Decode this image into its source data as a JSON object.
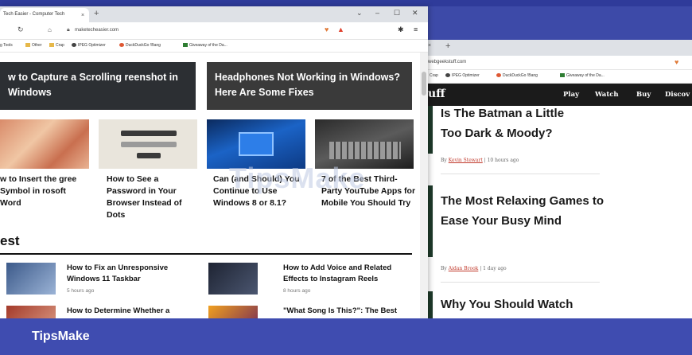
{
  "left_window": {
    "tab_title": "Tech Easier - Computer Tech",
    "tab_close": "×",
    "new_tab": "+",
    "window_controls": [
      "⌄",
      "–",
      "☐",
      "✕"
    ],
    "url": "maketecheasier.com",
    "bookmarks": [
      "g Tools",
      "Other",
      "Crap",
      "IPEG Optimizer",
      "DuckDuckGo !Bang",
      "Giveaway of the Da..."
    ],
    "hero": [
      "w to Capture a Scrolling reenshot in Windows",
      "Headphones Not Working in Windows? Here Are Some Fixes"
    ],
    "cards": [
      "w to Insert the gree Symbol in rosoft Word",
      "How to See a Password in Your Browser Instead of Dots",
      "Can (and Should) You Continue to Use Windows 8 or 8.1?",
      "7 of the Best Third-Party YouTube Apps for Mobile You Should Try"
    ],
    "latest_heading": "est",
    "latest": [
      {
        "title": "How to Fix an Unresponsive Windows 11 Taskbar",
        "time": "5 hours ago"
      },
      {
        "title": "How to Add Voice and Related Effects to Instagram Reels",
        "time": "8 hours ago"
      },
      {
        "title": "How to Determine Whether a",
        "time": ""
      },
      {
        "title": "\"What Song Is This?\": The Best",
        "time": ""
      }
    ]
  },
  "right_window": {
    "tab_close": "×",
    "new_tab": "+",
    "url": "webgeekstuff.com",
    "bookmarks": [
      "Crap",
      "IPEG Optimizer",
      "DuckDuckGo !Bang",
      "Giveaway of the Da..."
    ],
    "logo": "uff",
    "nav": [
      "Play",
      "Watch",
      "Buy",
      "Discov"
    ],
    "articles": [
      {
        "title": "Is The Batman a Little Too Dark & Moody?",
        "by": "By",
        "author": "Kevin Stewart",
        "time": "| 10 hours ago"
      },
      {
        "title": "The Most Relaxing Games to Ease Your Busy Mind",
        "by": "By",
        "author": "Aidan Brook",
        "time": "| 1 day ago"
      },
      {
        "title": "Why You Should Watch",
        "by": "",
        "author": "",
        "time": ""
      }
    ]
  },
  "watermark": "TipsMake",
  "banner": {
    "brand": "TipsMake"
  }
}
